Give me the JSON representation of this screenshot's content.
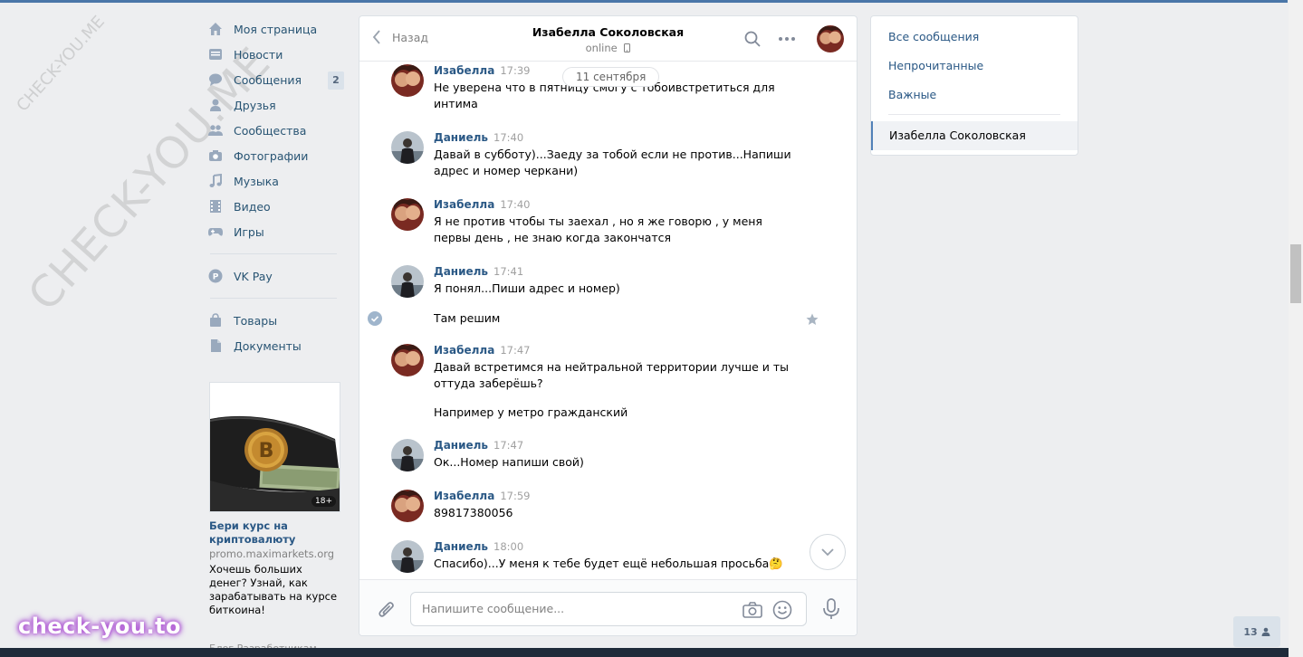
{
  "nav": {
    "items": [
      {
        "label": "Моя страница",
        "icon": "home-icon"
      },
      {
        "label": "Новости",
        "icon": "news-icon"
      },
      {
        "label": "Сообщения",
        "icon": "messages-icon",
        "badge": "2"
      },
      {
        "label": "Друзья",
        "icon": "friends-icon"
      },
      {
        "label": "Сообщества",
        "icon": "groups-icon"
      },
      {
        "label": "Фотографии",
        "icon": "camera-icon"
      },
      {
        "label": "Музыка",
        "icon": "music-icon"
      },
      {
        "label": "Видео",
        "icon": "video-icon"
      },
      {
        "label": "Игры",
        "icon": "gamepad-icon"
      }
    ],
    "vkpay": "VK Pay",
    "goods": "Товары",
    "docs": "Документы"
  },
  "ad": {
    "title": "Бери курс на криптовалюту",
    "domain": "promo.maximarkets.org",
    "text": "Хочешь больших денег? Узнай, как зарабатывать на курсе биткоина!",
    "age": "18+"
  },
  "footer": "Блог   Разработчикам",
  "watermark": {
    "small": "CHECK-YOU.ME",
    "big": "CHECK-YOU.ME",
    "bottom": "check-you.to"
  },
  "chat": {
    "back_label": "Назад",
    "peer_name": "Изабелла Соколовская",
    "peer_status": "online",
    "date_pill": "11 сентября",
    "messages": [
      {
        "author": "Изабелла",
        "time": "17:39",
        "text": "Не уверена что в пятницу смогу с тобоивстретиться для интима"
      },
      {
        "author": "Даниель",
        "time": "17:40",
        "text": "Давай в субботу)...Заеду за тобой если не против...Напиши адрес и номер черкани)"
      },
      {
        "author": "Изабелла",
        "time": "17:40",
        "text": "Я не против чтобы ты заехал , но я же говорю , у меня первы день , не знаю когда закончатся"
      },
      {
        "author": "Даниель",
        "time": "17:41",
        "text": "Я понял...Пиши адрес и номер)"
      },
      {
        "text": "Там решим"
      },
      {
        "author": "Изабелла",
        "time": "17:47",
        "text": "Давай встретимся на нейтральной территории лучше и ты оттуда заберёшь?"
      },
      {
        "text": "Например у метро гражданский"
      },
      {
        "author": "Даниель",
        "time": "17:47",
        "text": "Ок...Номер напиши свой)"
      },
      {
        "author": "Изабелла",
        "time": "17:59",
        "text": "89817380056"
      },
      {
        "author": "Даниель",
        "time": "18:00",
        "text": "Спасибо)...У меня к тебе будет ещё небольшая просьба🤔"
      }
    ],
    "input_placeholder": "Напишите сообщение..."
  },
  "rightnav": {
    "all": "Все сообщения",
    "unread": "Непрочитанные",
    "important": "Важные",
    "active": "Изабелла Соколовская"
  },
  "online_count": "13"
}
